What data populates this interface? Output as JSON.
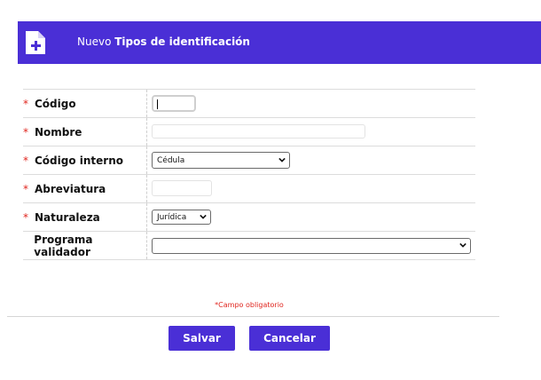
{
  "header": {
    "prefix": "Nuevo",
    "title": "Tipos de identificación",
    "icon": "document-add-icon"
  },
  "form": {
    "required_marker": "*",
    "fields": [
      {
        "label": "Código",
        "required": true,
        "value": ""
      },
      {
        "label": "Nombre",
        "required": true,
        "value": ""
      },
      {
        "label": "Código interno",
        "required": true,
        "selected": "Cédula"
      },
      {
        "label": "Abreviatura",
        "required": true,
        "value": ""
      },
      {
        "label": "Naturaleza",
        "required": true,
        "selected": "Jurídica"
      },
      {
        "label": "Programa validador",
        "required": false,
        "selected": ""
      }
    ]
  },
  "legend": "*Campo obligatorio",
  "buttons": {
    "save": "Salvar",
    "cancel": "Cancelar"
  },
  "colors": {
    "accent": "#4a2fd6",
    "required": "#e0261f"
  }
}
